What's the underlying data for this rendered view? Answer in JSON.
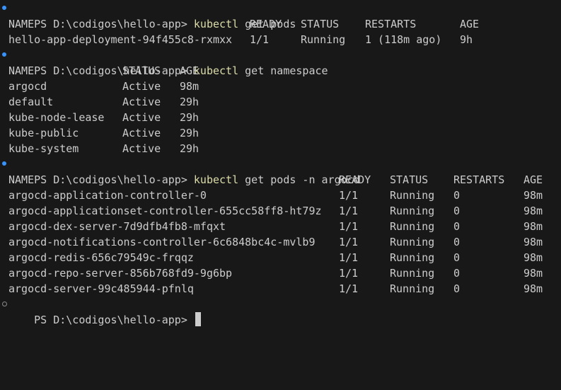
{
  "prompt": "PS D:\\codigos\\hello-app> ",
  "colors": {
    "background": "#181818",
    "text": "#cccccc",
    "command": "#dcdcaa",
    "prompt_marker": "#3794ff"
  },
  "blocks": [
    {
      "command": "kubectl",
      "args": " get pods",
      "headers": [
        "NAME",
        "READY",
        "STATUS",
        "RESTARTS",
        "AGE"
      ],
      "rows": [
        [
          "hello-app-deployment-94f455c8-rxmxx",
          "1/1",
          "Running",
          "1 (118m ago)",
          "9h"
        ]
      ]
    },
    {
      "command": "kubectl",
      "args": " get namespace",
      "headers": [
        "NAME",
        "STATUS",
        "AGE"
      ],
      "rows": [
        [
          "argocd",
          "Active",
          "98m"
        ],
        [
          "default",
          "Active",
          "29h"
        ],
        [
          "kube-node-lease",
          "Active",
          "29h"
        ],
        [
          "kube-public",
          "Active",
          "29h"
        ],
        [
          "kube-system",
          "Active",
          "29h"
        ]
      ]
    },
    {
      "command": "kubectl",
      "args": " get pods -n argocd",
      "headers": [
        "NAME",
        "READY",
        "STATUS",
        "RESTARTS",
        "AGE"
      ],
      "rows": [
        [
          "argocd-application-controller-0",
          "1/1",
          "Running",
          "0",
          "98m"
        ],
        [
          "argocd-applicationset-controller-655cc58ff8-ht79z",
          "1/1",
          "Running",
          "0",
          "98m"
        ],
        [
          "argocd-dex-server-7d9dfb4fb8-mfqxt",
          "1/1",
          "Running",
          "0",
          "98m"
        ],
        [
          "argocd-notifications-controller-6c6848bc4c-mvlb9",
          "1/1",
          "Running",
          "0",
          "98m"
        ],
        [
          "argocd-redis-656c79549c-frqqz",
          "1/1",
          "Running",
          "0",
          "98m"
        ],
        [
          "argocd-repo-server-856b768fd9-9g6bp",
          "1/1",
          "Running",
          "0",
          "98m"
        ],
        [
          "argocd-server-99c485944-pfnlq",
          "1/1",
          "Running",
          "0",
          "98m"
        ]
      ]
    }
  ]
}
